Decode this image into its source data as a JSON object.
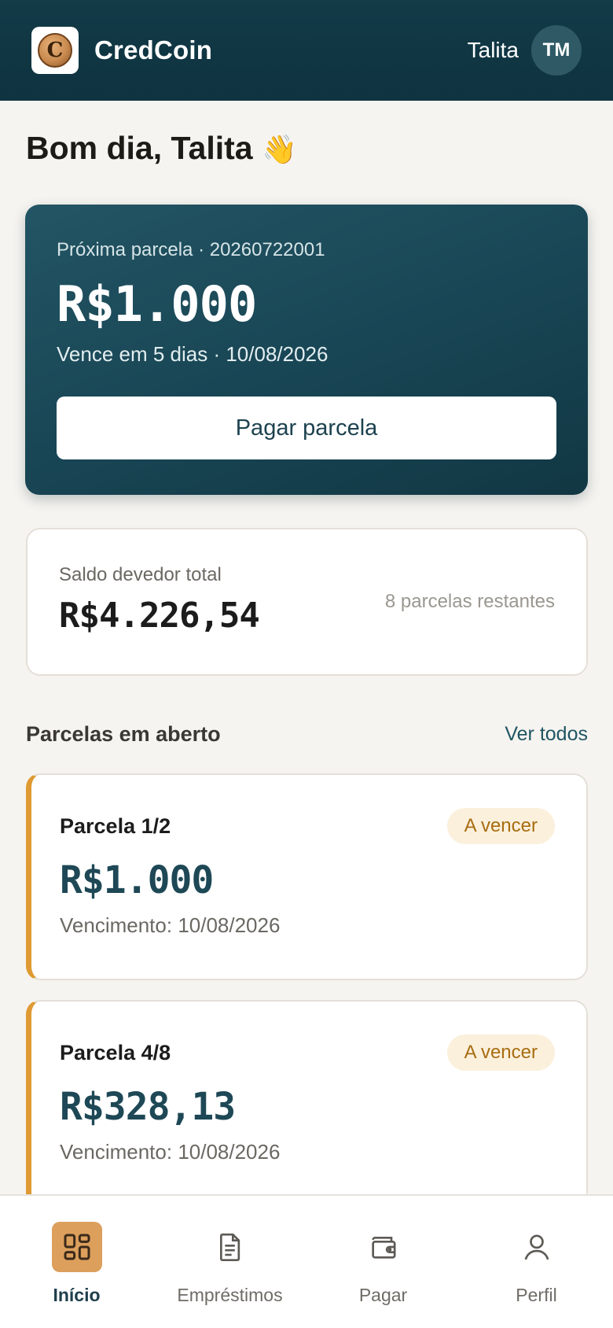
{
  "header": {
    "logo_letter": "C",
    "app_name": "CredCoin",
    "user_name": "Talita",
    "user_initials": "TM"
  },
  "greeting": {
    "text": "Bom dia, Talita",
    "emoji": "👋"
  },
  "next_installment": {
    "label": "Próxima parcela · 20260722001",
    "amount": "R$1.000",
    "due_text": "Vence em 5 dias · 10/08/2026",
    "pay_button": "Pagar parcela"
  },
  "balance": {
    "label": "Saldo devedor total",
    "amount": "R$4.226,54",
    "remaining": "8 parcelas restantes"
  },
  "open_installments": {
    "title": "Parcelas em aberto",
    "see_all": "Ver todos",
    "items": [
      {
        "title": "Parcela 1/2",
        "status": "A vencer",
        "amount": "R$1.000",
        "due": "Vencimento: 10/08/2026"
      },
      {
        "title": "Parcela 4/8",
        "status": "A vencer",
        "amount": "R$328,13",
        "due": "Vencimento: 10/08/2026"
      }
    ]
  },
  "nav": {
    "items": [
      {
        "label": "Início",
        "icon": "grid-icon",
        "active": true
      },
      {
        "label": "Empréstimos",
        "icon": "document-icon",
        "active": false
      },
      {
        "label": "Pagar",
        "icon": "wallet-icon",
        "active": false
      },
      {
        "label": "Perfil",
        "icon": "user-icon",
        "active": false
      }
    ]
  },
  "colors": {
    "header_bg": "#123a47",
    "card_bg": "#184554",
    "accent_orange": "#df9a33",
    "badge_bg": "#fbf0dc",
    "badge_text": "#a86d11",
    "amount_teal": "#1e4856",
    "active_nav": "#dc9f5c"
  }
}
